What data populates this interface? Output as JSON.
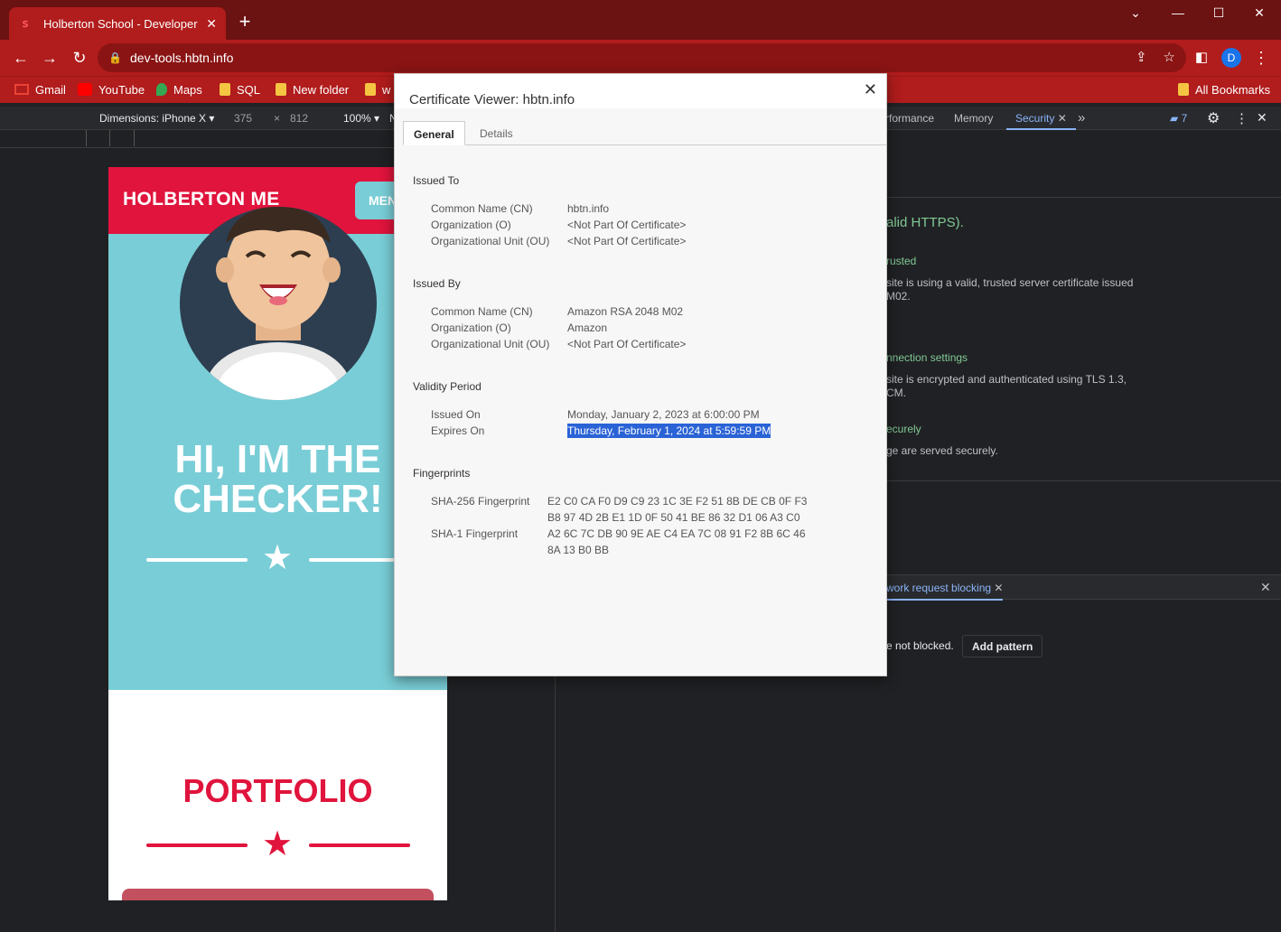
{
  "browser": {
    "tab_title": "Holberton School - Developer to",
    "url": "dev-tools.hbtn.info",
    "profile_initial": "D",
    "bookmarks": [
      "Gmail",
      "YouTube",
      "Maps",
      "SQL",
      "New folder",
      "w"
    ],
    "all_bookmarks": "All Bookmarks"
  },
  "device_toolbar": {
    "dimensions": "Dimensions: iPhone X",
    "width": "375",
    "times": "×",
    "height": "812",
    "zoom": "100%",
    "trunc": "N"
  },
  "devtools": {
    "tabs": [
      "rformance",
      "Memory",
      "Security"
    ],
    "more": "»",
    "issues_count": "7",
    "summary": "alid HTTPS).",
    "cert_heading": "rusted",
    "cert_text_1": "site is using a valid, trusted server certificate issued",
    "cert_text_2": "M02.",
    "conn_heading": "nnection settings",
    "conn_text_1": "site is encrypted and authenticated using TLS 1.3,",
    "conn_text_2": "CM.",
    "res_heading": "ecurely",
    "res_text": "ge are served securely.",
    "drawer_tab": "work request blocking",
    "drawer_text": "e not blocked.",
    "add_pattern": "Add pattern"
  },
  "mobile_page": {
    "brand": "HOLBERTON ME",
    "menu_label": "MEN",
    "hero_line1": "HI, I'M THE",
    "hero_line2": "CHECKER!",
    "portfolio": "PORTFOLIO"
  },
  "certificate": {
    "title": "Certificate Viewer: hbtn.info",
    "tabs": [
      "General",
      "Details"
    ],
    "issued_to": {
      "heading": "Issued To",
      "rows": [
        {
          "label": "Common Name (CN)",
          "value": "hbtn.info"
        },
        {
          "label": "Organization (O)",
          "value": "<Not Part Of Certificate>"
        },
        {
          "label": "Organizational Unit (OU)",
          "value": "<Not Part Of Certificate>"
        }
      ]
    },
    "issued_by": {
      "heading": "Issued By",
      "rows": [
        {
          "label": "Common Name (CN)",
          "value": "Amazon RSA 2048 M02"
        },
        {
          "label": "Organization (O)",
          "value": "Amazon"
        },
        {
          "label": "Organizational Unit (OU)",
          "value": "<Not Part Of Certificate>"
        }
      ]
    },
    "validity": {
      "heading": "Validity Period",
      "rows": [
        {
          "label": "Issued On",
          "value": "Monday, January 2, 2023 at 6:00:00 PM"
        },
        {
          "label": "Expires On",
          "value": "Thursday, February 1, 2024 at 5:59:59 PM"
        }
      ]
    },
    "fingerprints": {
      "heading": "Fingerprints",
      "sha256_label": "SHA-256 Fingerprint",
      "sha256_l1": "E2 C0 CA F0 D9 C9 23 1C 3E F2 51 8B DE CB 0F F3",
      "sha256_l2": "B8 97 4D 2B E1 1D 0F 50 41 BE 86 32 D1 06 A3 C0",
      "sha1_label": "SHA-1 Fingerprint",
      "sha1_l1": "A2 6C 7C DB 90 9E AE C4 EA 7C 08 91 F2 8B 6C 46",
      "sha1_l2": "8A 13 B0 BB"
    }
  },
  "colors": {
    "chrome_red": "#b11c1c",
    "brand_red": "#e0143c",
    "hero_teal": "#79cdd6",
    "selection": "#2a63d6"
  }
}
